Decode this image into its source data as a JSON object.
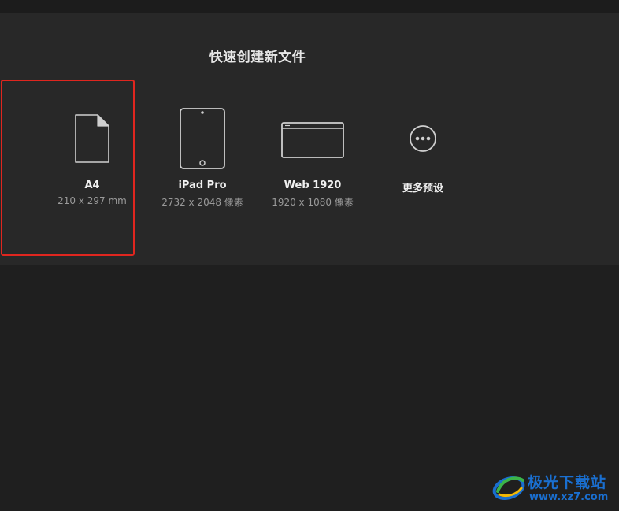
{
  "panel": {
    "title": "快速创建新文件"
  },
  "presets": [
    {
      "name": "A4",
      "size": "210 x 297 mm",
      "icon": "document-icon"
    },
    {
      "name": "iPad Pro",
      "size": "2732 x 2048 像素",
      "icon": "tablet-icon"
    },
    {
      "name": "Web 1920",
      "size": "1920 x 1080 像素",
      "icon": "browser-window-icon"
    },
    {
      "name": "更多预设",
      "size": "",
      "icon": "more-icon"
    }
  ],
  "highlight": {
    "color": "#e0261f",
    "target": "A4"
  },
  "watermark": {
    "brand": "极光下载站",
    "url": "www.xz7.com"
  }
}
